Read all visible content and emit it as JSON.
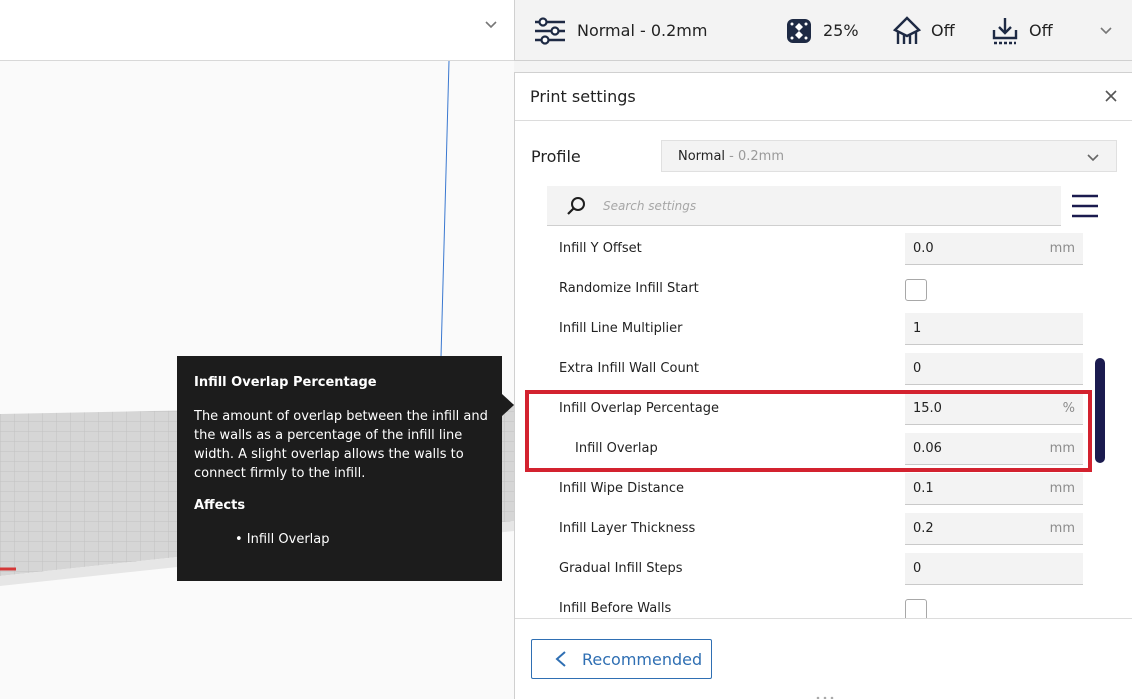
{
  "header": {
    "profile_text": "Normal - 0.2mm",
    "infill_text": "25%",
    "support_text": "Off",
    "adhesion_text": "Off"
  },
  "panel": {
    "title": "Print settings",
    "profile_label": "Profile",
    "profile_value": "Normal",
    "profile_sub": " - 0.2mm",
    "search_placeholder": "Search settings",
    "footer_button": "Recommended"
  },
  "settings": [
    {
      "label": "Infill Y Offset",
      "type": "field",
      "value": "0.0",
      "unit": "mm"
    },
    {
      "label": "Randomize Infill Start",
      "type": "checkbox",
      "checked": false
    },
    {
      "label": "Infill Line Multiplier",
      "type": "field",
      "value": "1",
      "unit": ""
    },
    {
      "label": "Extra Infill Wall Count",
      "type": "field",
      "value": "0",
      "unit": ""
    },
    {
      "label": "Infill Overlap Percentage",
      "type": "field",
      "value": "15.0",
      "unit": "%"
    },
    {
      "label": "Infill Overlap",
      "type": "field",
      "value": "0.06",
      "unit": "mm",
      "child": true
    },
    {
      "label": "Infill Wipe Distance",
      "type": "field",
      "value": "0.1",
      "unit": "mm"
    },
    {
      "label": "Infill Layer Thickness",
      "type": "field",
      "value": "0.2",
      "unit": "mm"
    },
    {
      "label": "Gradual Infill Steps",
      "type": "field",
      "value": "0",
      "unit": ""
    },
    {
      "label": "Infill Before Walls",
      "type": "checkbox",
      "checked": false
    }
  ],
  "tooltip": {
    "title": "Infill Overlap Percentage",
    "description": "The amount of overlap between the infill and the walls as a percentage of the infill line width. A slight overlap allows the walls to connect firmly to the infill.",
    "affects_label": "Affects",
    "affected_item": "• Infill Overlap"
  },
  "icons": {
    "profile": "sliders-icon",
    "infill": "infill-icon",
    "support": "support-icon",
    "adhesion": "adhesion-icon"
  },
  "colors": {
    "accent": "#2f6fb3",
    "highlight": "#d3222f",
    "scrollbar": "#1b1b4f",
    "tooltip_bg": "#1c1c1c"
  }
}
